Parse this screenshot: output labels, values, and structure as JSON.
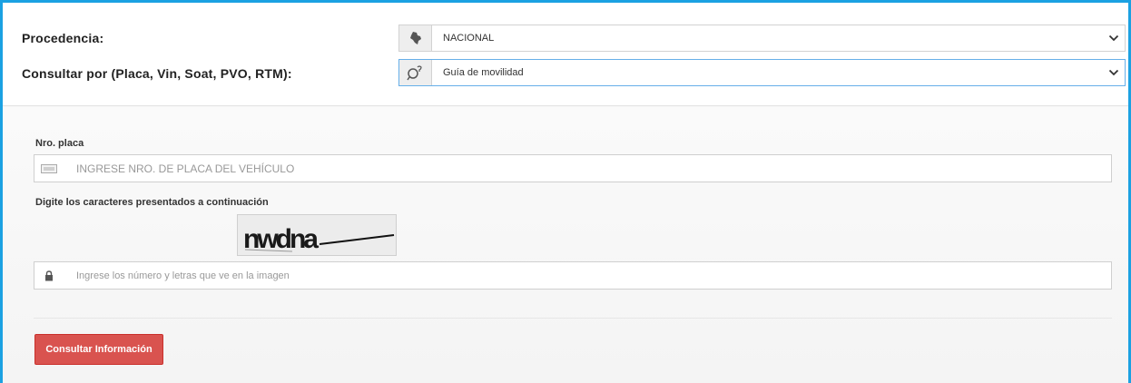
{
  "form": {
    "procedencia_label": "Procedencia:",
    "procedencia_value": "NACIONAL",
    "consultar_por_label": "Consultar por (Placa, Vin, Soat, PVO, RTM):",
    "consultar_por_value": "Guía de movilidad",
    "placa_label": "Nro. placa",
    "placa_placeholder": "INGRESE NRO. DE PLACA DEL VEHÍCULO",
    "captcha_label": "Digite los caracteres presentados a continuación",
    "captcha_text": "nwdna",
    "captcha_placeholder": "Ingrese los número y letras que ve en la imagen",
    "submit_label": "Consultar Información"
  },
  "colors": {
    "frame_border": "#1ba1e2",
    "button": "#d9534f",
    "active_border": "#66afe9"
  }
}
